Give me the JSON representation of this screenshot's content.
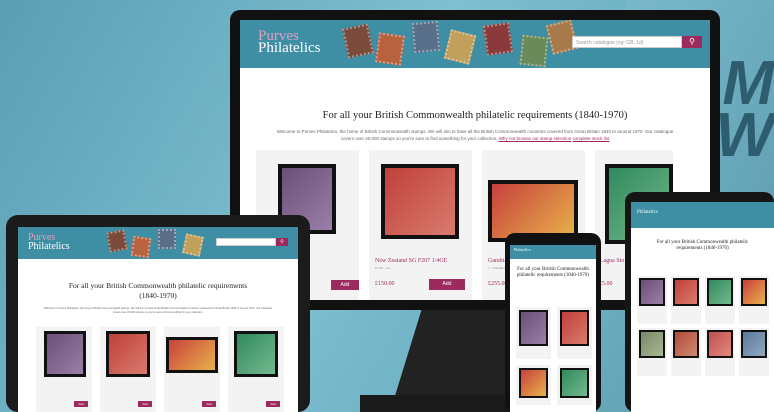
{
  "ghost": {
    "line1": "M",
    "line2": "W"
  },
  "site": {
    "logo_line1": "Purves",
    "logo_line2": "Philatelics",
    "search_placeholder": "Search catalogue (eg: GB, 1d)",
    "search_icon": "search-icon",
    "heading": "For all your British Commonwealth philatelic requirements (1840-1970)",
    "intro": "Welcome to Purves Philatelics, the home of British Commonwealth stamps. We will aim to have all the British Commonwealth countries covered from Great Britain 1840 to around 1970. Our catalogue covers over 20,000 stamps so you're sure to find something for your collection.",
    "intro_link1": "Why not browse our stamp selection",
    "intro_link2": "complete stock list",
    "accent": "#9d2a5f",
    "header_color": "#3e8ea4"
  },
  "products": [
    {
      "name": "",
      "price": "",
      "add": "Add",
      "colors": [
        "#6b4f7a",
        "#9a7fa8"
      ]
    },
    {
      "name": "New Zealand SG F207 1/4GE",
      "subline": "£7.50 - cat.",
      "price": "£150.00",
      "add": "Add",
      "colors": [
        "#c0403b",
        "#d97b6e"
      ]
    },
    {
      "name": "Gambia",
      "subline": "1 / 4 Elephants",
      "price": "£255.00",
      "add": "Add",
      "colors": [
        "#c8403d",
        "#e8b24a"
      ]
    },
    {
      "name": "...agua Sto",
      "subline": "",
      "price": "£5.00",
      "add": "Add",
      "colors": [
        "#2f8a5c",
        "#74b98f"
      ]
    }
  ],
  "phone": {
    "heading": "For all your British Commonwealth philatelic requirements (1840-1970)"
  },
  "tablet": {
    "heading": "For all your British Commonwealth philatelic requirements (1840-1970)"
  }
}
